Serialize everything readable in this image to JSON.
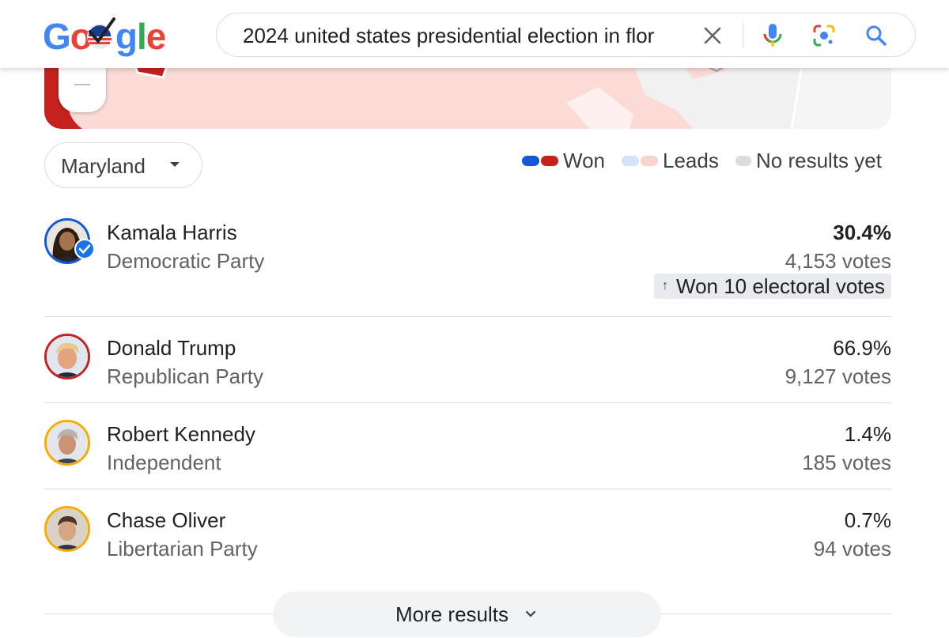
{
  "header": {
    "logo_text": "Google",
    "search_query": "2024 united states presidential election in flor"
  },
  "state_selector": {
    "selected": "Maryland"
  },
  "legend": {
    "won": "Won",
    "leads": "Leads",
    "no_results": "No results yet",
    "colors": {
      "dem_won": "#1558d6",
      "rep_won": "#c5221f",
      "dem_leads": "#d2e3fc",
      "rep_leads": "#fad2cf",
      "none": "#dadce0"
    }
  },
  "candidates": [
    {
      "name": "Kamala Harris",
      "party": "Democratic Party",
      "percent": "30.4%",
      "votes": "4,153 votes",
      "won_label": "Won 10 electoral votes",
      "ring_color": "#1558d6"
    },
    {
      "name": "Donald Trump",
      "party": "Republican Party",
      "percent": "66.9%",
      "votes": "9,127 votes",
      "ring_color": "#c5221f"
    },
    {
      "name": "Robert Kennedy",
      "party": "Independent",
      "percent": "1.4%",
      "votes": "185 votes",
      "ring_color": "#f9ab00"
    },
    {
      "name": "Chase Oliver",
      "party": "Libertarian Party",
      "percent": "0.7%",
      "votes": "94 votes",
      "ring_color": "#f9ab00"
    }
  ],
  "more_results": {
    "label": "More results"
  }
}
